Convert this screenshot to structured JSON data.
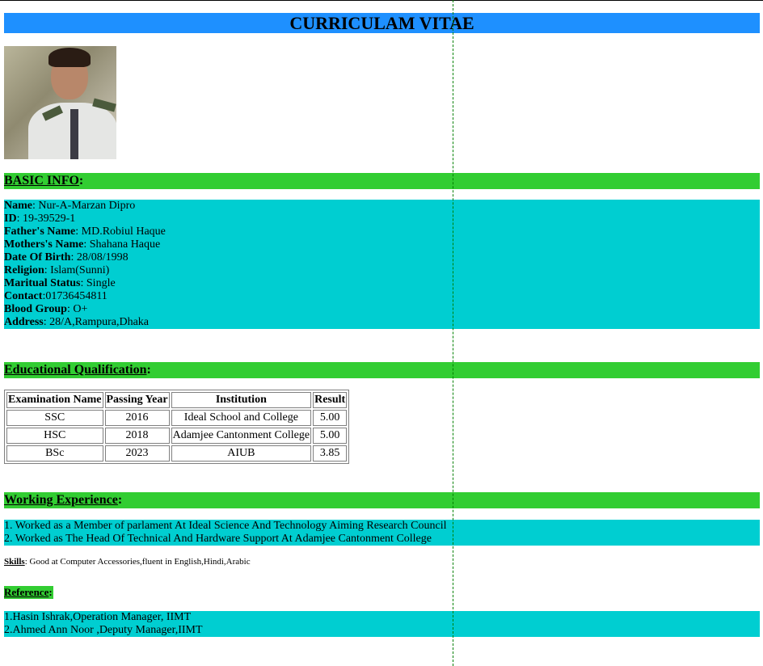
{
  "header": {
    "title": "CURRICULAM VITAE"
  },
  "basic_info": {
    "heading": "BASIC INFO",
    "fields": [
      {
        "label": "Name",
        "value": ": Nur-A-Marzan Dipro"
      },
      {
        "label": "ID",
        "value": ": 19-39529-1"
      },
      {
        "label": "Father's Name",
        "value": ": MD.Robiul Haque"
      },
      {
        "label": "Mothers's Name",
        "value": ": Shahana Haque"
      },
      {
        "label": "Date Of Birth",
        "value": ": 28/08/1998"
      },
      {
        "label": "Religion",
        "value": ": Islam(Sunni)"
      },
      {
        "label": "Maritual Status",
        "value": ": Single"
      },
      {
        "label": "Contact",
        "value": ":01736454811"
      },
      {
        "label": "Blood Group",
        "value": ": O+"
      },
      {
        "label": "Address",
        "value": ": 28/A,Rampura,Dhaka"
      }
    ]
  },
  "education": {
    "heading": "Educational Qualification",
    "columns": [
      "Examination Name",
      "Passing Year",
      "Institution",
      "Result"
    ],
    "rows": [
      [
        "SSC",
        "2016",
        "Ideal School and College",
        "5.00"
      ],
      [
        "HSC",
        "2018",
        "Adamjee Cantonment College",
        "5.00"
      ],
      [
        "BSc",
        "2023",
        "AIUB",
        "3.85"
      ]
    ]
  },
  "experience": {
    "heading": "Working Experience",
    "items": [
      "1. Worked as a Member of parlament At Ideal Science And Technology Aiming Research Council",
      "2. Worked as The Head Of Technical And Hardware Support At Adamjee Cantonment College"
    ]
  },
  "skills": {
    "label": "Skills",
    "value": ": Good at Computer Accessories,fluent in English,Hindi,Arabic"
  },
  "reference": {
    "heading": "Reference",
    "items": [
      "1.Hasin Ishrak,Operation Manager, IIMT",
      "2.Ahmed Ann Noor ,Deputy Manager,IIMT"
    ]
  },
  "colors": {
    "title_bar": "#1e90ff",
    "section_head": "#32cd32",
    "info_block": "#00ced1"
  }
}
